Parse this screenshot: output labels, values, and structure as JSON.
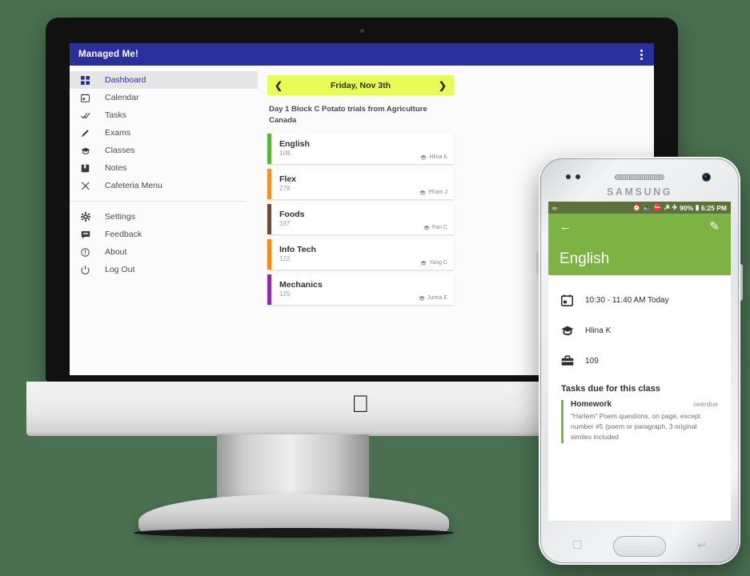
{
  "desktop": {
    "app_title": "Managed Me!",
    "overflow_menu_icon": "kebab-menu-icon",
    "sidebar": {
      "items": [
        {
          "label": "Dashboard",
          "icon": "dashboard-grid-icon",
          "active": true
        },
        {
          "label": "Calendar",
          "icon": "calendar-icon",
          "active": false
        },
        {
          "label": "Tasks",
          "icon": "double-check-icon",
          "active": false
        },
        {
          "label": "Exams",
          "icon": "pencil-icon",
          "active": false
        },
        {
          "label": "Classes",
          "icon": "graduation-cap-icon",
          "active": false
        },
        {
          "label": "Notes",
          "icon": "book-icon",
          "active": false
        },
        {
          "label": "Cafeteria Menu",
          "icon": "fork-knife-icon",
          "active": false
        }
      ],
      "footer_items": [
        {
          "label": "Settings",
          "icon": "gear-icon"
        },
        {
          "label": "Feedback",
          "icon": "comment-icon"
        },
        {
          "label": "About",
          "icon": "info-circle-icon"
        },
        {
          "label": "Log Out",
          "icon": "power-icon"
        }
      ]
    },
    "datebar": {
      "prev_icon": "chevron-left-icon",
      "next_icon": "chevron-right-icon",
      "date": "Friday, Nov 3th",
      "bg_color": "#e8fc57"
    },
    "announcement": "Day 1 Block C Potato trials from Agriculture Canada",
    "classes": [
      {
        "name": "English",
        "room": "109",
        "teacher": "Hlina K",
        "color": "#5cb335"
      },
      {
        "name": "Flex",
        "room": "278",
        "teacher": "Pham J",
        "color": "#f2912a"
      },
      {
        "name": "Foods",
        "room": "197",
        "teacher": "Fan C",
        "color": "#6b4b3a"
      },
      {
        "name": "Info Tech",
        "room": "122",
        "teacher": "Yang C",
        "color": "#f98b10"
      },
      {
        "name": "Mechanics",
        "room": "125",
        "teacher": "Jurica E",
        "color": "#8a2ea8"
      }
    ],
    "teacher_icon": "graduation-cap-icon"
  },
  "phone": {
    "brand": "SAMSUNG",
    "statusbar": {
      "left_icon": "infinity-icon",
      "icons": [
        "alarm-icon",
        "mute-icon",
        "dnd-icon",
        "wifi-icon",
        "airplane-icon"
      ],
      "battery": "90%",
      "battery_icon": "battery-icon",
      "time": "6:25 PM",
      "bg_color": "#5d7238"
    },
    "header": {
      "back_icon": "back-arrow-icon",
      "edit_icon": "pencil-edit-icon",
      "title": "English",
      "bg_color": "#7cb342"
    },
    "details": [
      {
        "icon": "calendar-icon",
        "text": "10:30 - 11:40 AM Today"
      },
      {
        "icon": "graduation-cap-icon",
        "text": "Hlina K"
      },
      {
        "icon": "briefcase-icon",
        "text": "109"
      }
    ],
    "tasks_heading": "Tasks due for this class",
    "tasks": [
      {
        "name": "Homework",
        "status": "overdue",
        "description": "\"Harlem\" Poem questions, on page, except number #5 (poem or paragraph, 3 original similes included",
        "accent": "#7cb342"
      }
    ],
    "nav": {
      "recents_icon": "recents-icon",
      "home_icon": "home-button",
      "back_icon": "back-nav-icon"
    }
  }
}
